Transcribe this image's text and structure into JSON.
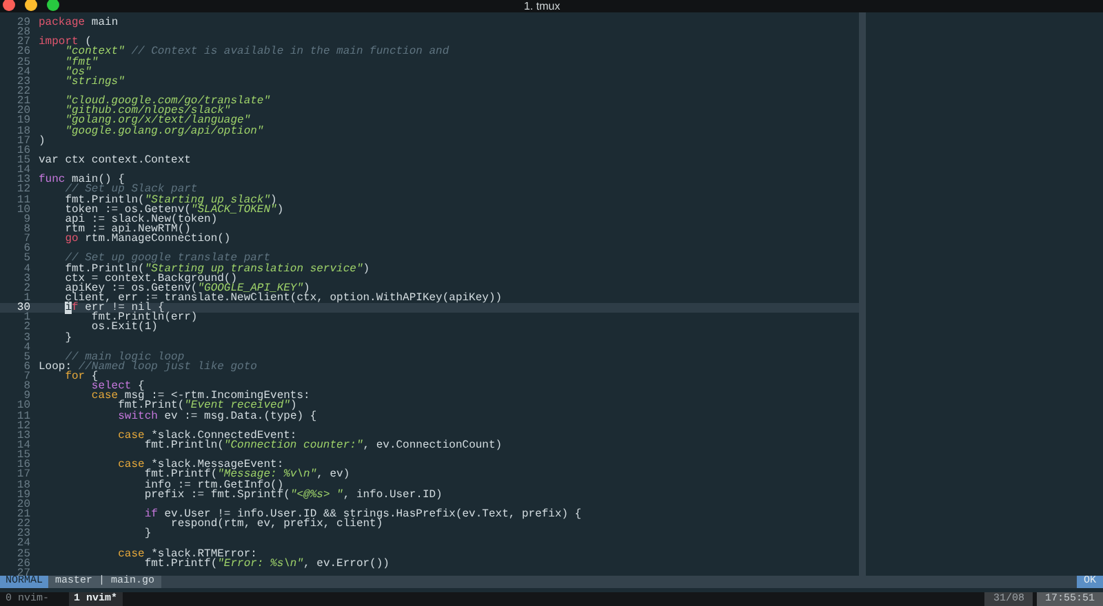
{
  "window": {
    "title": "1. tmux"
  },
  "editor": {
    "lines": [
      {
        "number": "29",
        "current": false,
        "tokens": [
          {
            "kind": "keyword",
            "text": "package"
          },
          {
            "kind": "plain",
            "text": " main"
          }
        ]
      },
      {
        "number": "28",
        "current": false
      },
      {
        "number": "27",
        "current": false,
        "tokens": [
          {
            "kind": "keyword",
            "text": "import"
          },
          {
            "kind": "plain",
            "text": " ("
          }
        ]
      },
      {
        "number": "26",
        "current": false,
        "tokens": [
          {
            "kind": "string",
            "text": "    \"context\""
          },
          {
            "kind": "comment",
            "text": " // Context is available in the main function and"
          }
        ]
      },
      {
        "number": "25",
        "current": false,
        "tokens": [
          {
            "kind": "string",
            "text": "    \"fmt\""
          }
        ]
      },
      {
        "number": "24",
        "current": false,
        "tokens": [
          {
            "kind": "string",
            "text": "    \"os\""
          }
        ]
      },
      {
        "number": "23",
        "current": false,
        "tokens": [
          {
            "kind": "string",
            "text": "    \"strings\""
          }
        ]
      },
      {
        "number": "22",
        "current": false
      },
      {
        "number": "21",
        "current": false,
        "tokens": [
          {
            "kind": "string",
            "text": "    \"cloud.google.com/go/translate\""
          }
        ]
      },
      {
        "number": "20",
        "current": false,
        "tokens": [
          {
            "kind": "string",
            "text": "    \"github.com/nlopes/slack\""
          }
        ]
      },
      {
        "number": "19",
        "current": false,
        "tokens": [
          {
            "kind": "string",
            "text": "    \"golang.org/x/text/language\""
          }
        ]
      },
      {
        "number": "18",
        "current": false,
        "tokens": [
          {
            "kind": "string",
            "text": "    \"google.golang.org/api/option\""
          }
        ]
      },
      {
        "number": "17",
        "current": false,
        "tokens": [
          {
            "kind": "plain",
            "text": ")"
          }
        ]
      },
      {
        "number": "16",
        "current": false
      },
      {
        "number": "15",
        "current": false,
        "tokens": [
          {
            "kind": "plain",
            "text": "var ctx context.Context"
          }
        ]
      },
      {
        "number": "14",
        "current": false
      },
      {
        "number": "13",
        "current": false,
        "tokens": [
          {
            "kind": "special",
            "text": "func"
          },
          {
            "kind": "plain",
            "text": " main() {"
          }
        ]
      },
      {
        "number": "12",
        "current": false,
        "tokens": [
          {
            "kind": "comment",
            "text": "    // Set up Slack part"
          }
        ]
      },
      {
        "number": "11",
        "current": false,
        "tokens": [
          {
            "kind": "plain",
            "text": "    fmt.Println("
          },
          {
            "kind": "string",
            "text": "\"Starting up slack\""
          },
          {
            "kind": "plain",
            "text": ")"
          }
        ]
      },
      {
        "number": "10",
        "current": false,
        "tokens": [
          {
            "kind": "plain",
            "text": "    token := os.Getenv("
          },
          {
            "kind": "string",
            "text": "\"SLACK_TOKEN\""
          },
          {
            "kind": "plain",
            "text": ")"
          }
        ]
      },
      {
        "number": "9",
        "current": false,
        "tokens": [
          {
            "kind": "plain",
            "text": "    api := slack.New(token)"
          }
        ]
      },
      {
        "number": "8",
        "current": false,
        "tokens": [
          {
            "kind": "plain",
            "text": "    rtm := api.NewRTM()"
          }
        ]
      },
      {
        "number": "7",
        "current": false,
        "tokens": [
          {
            "kind": "keyword",
            "text": "    go"
          },
          {
            "kind": "plain",
            "text": " rtm.ManageConnection()"
          }
        ]
      },
      {
        "number": "6",
        "current": false
      },
      {
        "number": "5",
        "current": false,
        "tokens": [
          {
            "kind": "comment",
            "text": "    // Set up google translate part"
          }
        ]
      },
      {
        "number": "4",
        "current": false,
        "tokens": [
          {
            "kind": "plain",
            "text": "    fmt.Println("
          },
          {
            "kind": "string",
            "text": "\"Starting up translation service\""
          },
          {
            "kind": "plain",
            "text": ")"
          }
        ]
      },
      {
        "number": "3",
        "current": false,
        "tokens": [
          {
            "kind": "plain",
            "text": "    ctx = context.Background()"
          }
        ]
      },
      {
        "number": "2",
        "current": false,
        "tokens": [
          {
            "kind": "plain",
            "text": "    apiKey := os.Getenv("
          },
          {
            "kind": "string",
            "text": "\"GOOGLE_API_KEY\""
          },
          {
            "kind": "plain",
            "text": ")"
          }
        ]
      },
      {
        "number": "1",
        "current": false,
        "tokens": [
          {
            "kind": "plain",
            "text": "    client, err := translate.NewClient(ctx, option.WithAPIKey(apiKey))"
          }
        ]
      },
      {
        "number": "30",
        "current": true,
        "tokens": [
          {
            "kind": "cursor",
            "text": "    i"
          },
          {
            "kind": "keyword",
            "text": "f"
          },
          {
            "kind": "plain",
            "text": " err != nil {"
          }
        ]
      },
      {
        "number": "1",
        "current": false,
        "tokens": [
          {
            "kind": "plain",
            "text": "        fmt.Println(err)"
          }
        ]
      },
      {
        "number": "2",
        "current": false,
        "tokens": [
          {
            "kind": "plain",
            "text": "        os.Exit(1)"
          }
        ]
      },
      {
        "number": "3",
        "current": false,
        "tokens": [
          {
            "kind": "plain",
            "text": "    }"
          }
        ]
      },
      {
        "number": "4",
        "current": false
      },
      {
        "number": "5",
        "current": false,
        "tokens": [
          {
            "kind": "comment",
            "text": "    // main logic loop"
          }
        ]
      },
      {
        "number": "6",
        "current": false,
        "tokens": [
          {
            "kind": "plain",
            "text": "Loop: "
          },
          {
            "kind": "comment",
            "text": "//Named loop just like goto"
          }
        ]
      },
      {
        "number": "7",
        "current": false,
        "tokens": [
          {
            "kind": "control",
            "text": "    for"
          },
          {
            "kind": "plain",
            "text": " {"
          }
        ]
      },
      {
        "number": "8",
        "current": false,
        "tokens": [
          {
            "kind": "special",
            "text": "        select"
          },
          {
            "kind": "plain",
            "text": " {"
          }
        ]
      },
      {
        "number": "9",
        "current": false,
        "tokens": [
          {
            "kind": "control",
            "text": "        case"
          },
          {
            "kind": "plain",
            "text": " msg := <-rtm.IncomingEvents:"
          }
        ]
      },
      {
        "number": "10",
        "current": false,
        "tokens": [
          {
            "kind": "plain",
            "text": "            fmt.Print("
          },
          {
            "kind": "string",
            "text": "\"Event received\""
          },
          {
            "kind": "plain",
            "text": ")"
          }
        ]
      },
      {
        "number": "11",
        "current": false,
        "tokens": [
          {
            "kind": "special",
            "text": "            switch"
          },
          {
            "kind": "plain",
            "text": " ev := msg.Data.(type) {"
          }
        ]
      },
      {
        "number": "12",
        "current": false
      },
      {
        "number": "13",
        "current": false,
        "tokens": [
          {
            "kind": "control",
            "text": "            case"
          },
          {
            "kind": "plain",
            "text": " *slack.ConnectedEvent:"
          }
        ]
      },
      {
        "number": "14",
        "current": false,
        "tokens": [
          {
            "kind": "plain",
            "text": "                fmt.Println("
          },
          {
            "kind": "string",
            "text": "\"Connection counter:\""
          },
          {
            "kind": "plain",
            "text": ", ev.ConnectionCount)"
          }
        ]
      },
      {
        "number": "15",
        "current": false
      },
      {
        "number": "16",
        "current": false,
        "tokens": [
          {
            "kind": "control",
            "text": "            case"
          },
          {
            "kind": "plain",
            "text": " *slack.MessageEvent:"
          }
        ]
      },
      {
        "number": "17",
        "current": false,
        "tokens": [
          {
            "kind": "plain",
            "text": "                fmt.Printf("
          },
          {
            "kind": "string",
            "text": "\"Message: %v\\n\""
          },
          {
            "kind": "plain",
            "text": ", ev)"
          }
        ]
      },
      {
        "number": "18",
        "current": false,
        "tokens": [
          {
            "kind": "plain",
            "text": "                info := rtm.GetInfo()"
          }
        ]
      },
      {
        "number": "19",
        "current": false,
        "tokens": [
          {
            "kind": "plain",
            "text": "                prefix := fmt.Sprintf("
          },
          {
            "kind": "string",
            "text": "\"<@%s> \""
          },
          {
            "kind": "plain",
            "text": ", info.User.ID)"
          }
        ]
      },
      {
        "number": "20",
        "current": false
      },
      {
        "number": "21",
        "current": false,
        "tokens": [
          {
            "kind": "special",
            "text": "                if"
          },
          {
            "kind": "plain",
            "text": " ev.User != info.User.ID && strings.HasPrefix(ev.Text, prefix) {"
          }
        ]
      },
      {
        "number": "22",
        "current": false,
        "tokens": [
          {
            "kind": "plain",
            "text": "                    respond(rtm, ev, prefix, client)"
          }
        ]
      },
      {
        "number": "23",
        "current": false,
        "tokens": [
          {
            "kind": "plain",
            "text": "                }"
          }
        ]
      },
      {
        "number": "24",
        "current": false
      },
      {
        "number": "25",
        "current": false,
        "tokens": [
          {
            "kind": "control",
            "text": "            case"
          },
          {
            "kind": "plain",
            "text": " *slack.RTMError:"
          }
        ]
      },
      {
        "number": "26",
        "current": false,
        "tokens": [
          {
            "kind": "plain",
            "text": "                fmt.Printf("
          },
          {
            "kind": "string",
            "text": "\"Error: %s\\n\""
          },
          {
            "kind": "plain",
            "text": ", ev.Error())"
          }
        ]
      },
      {
        "number": "27",
        "current": false
      }
    ]
  },
  "status_line": {
    "mode": "NORMAL",
    "branch_file": "master | main.go",
    "message": "OK"
  },
  "tmux": {
    "windows": [
      {
        "label": "0 nvim-",
        "selected": false
      },
      {
        "label": "1 nvim*",
        "selected": true
      }
    ],
    "date": "31/08",
    "time": "17:55:51"
  }
}
